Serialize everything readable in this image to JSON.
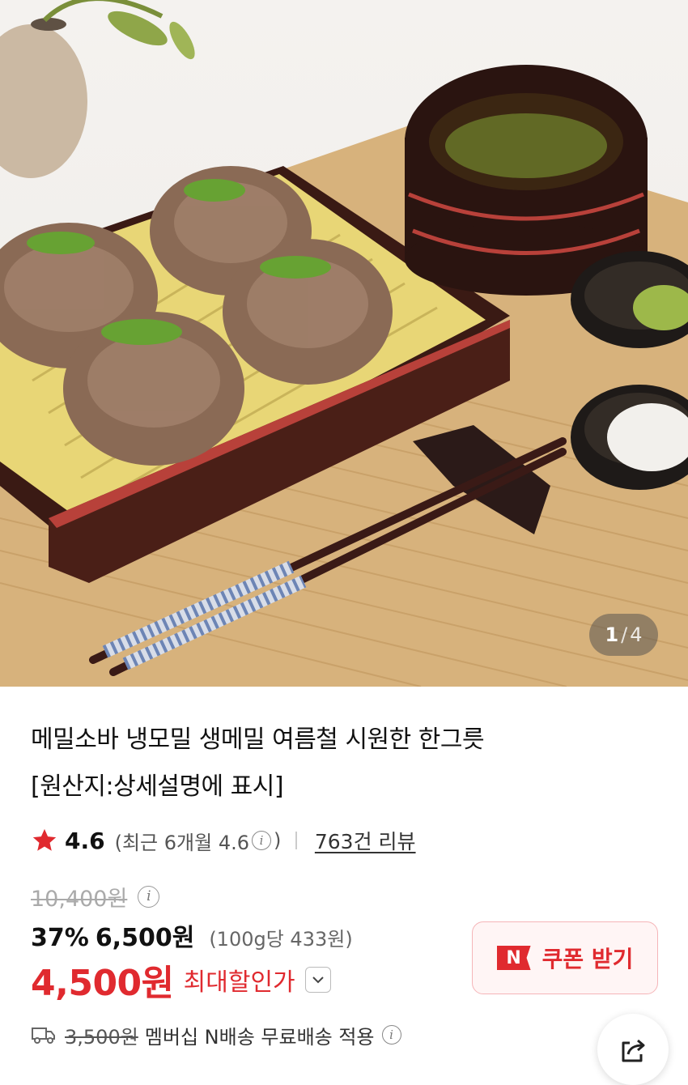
{
  "image": {
    "alt_icon": "product-photo",
    "counter": {
      "current": "1",
      "separator": "/",
      "total": "4"
    }
  },
  "product": {
    "title_line1": "메밀소바 냉모밀 생메밀 여름철 시원한 한그릇",
    "title_line2": "[원산지:상세설명에 표시]"
  },
  "rating": {
    "value": "4.6",
    "recent_prefix": "(최근 6개월 4.6",
    "recent_suffix": ")",
    "reviews": "763건 리뷰"
  },
  "price": {
    "original": "10,400원",
    "discount_rate": "37%",
    "sale": "6,500원",
    "unit": "(100g당 433원)",
    "max_discount_price": "4,500원",
    "max_discount_label": "최대할인가"
  },
  "coupon": {
    "badge": "N",
    "label": "쿠폰 받기"
  },
  "shipping": {
    "fee": "3,500원",
    "text": "멤버십 N배송 무료배송 적용"
  },
  "colors": {
    "accent_red": "#e02a2f",
    "coupon_bg": "#fff5f5"
  }
}
